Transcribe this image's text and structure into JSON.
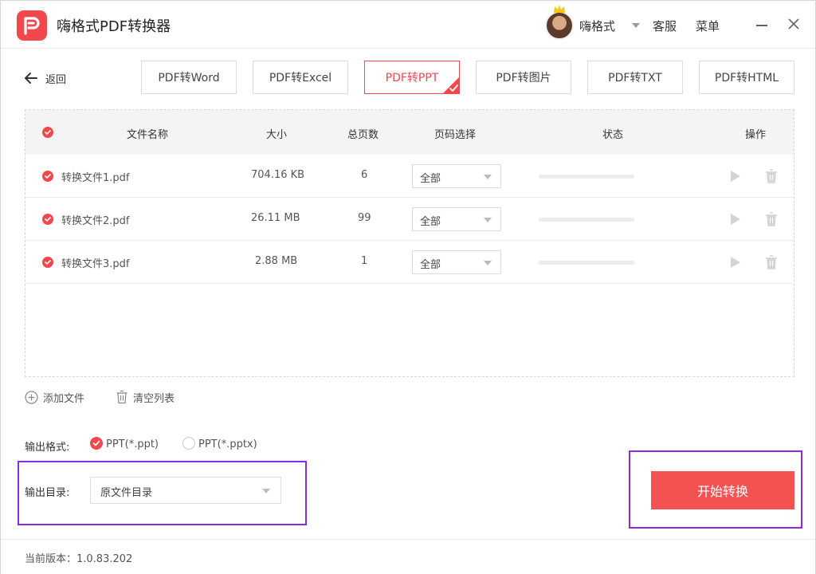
{
  "app": {
    "title": "嗨格式PDF转换器",
    "user_name": "嗨格式",
    "service": "客服",
    "menu": "菜单"
  },
  "toolbar": {
    "back_label": "返回",
    "tabs": [
      {
        "label": "PDF转Word",
        "active": false
      },
      {
        "label": "PDF转Excel",
        "active": false
      },
      {
        "label": "PDF转PPT",
        "active": true
      },
      {
        "label": "PDF转图片",
        "active": false
      },
      {
        "label": "PDF转TXT",
        "active": false
      },
      {
        "label": "PDF转HTML",
        "active": false
      }
    ]
  },
  "table": {
    "headers": {
      "name": "文件名称",
      "size": "大小",
      "pages": "总页数",
      "page_select": "页码选择",
      "status": "状态",
      "action": "操作"
    },
    "rows": [
      {
        "name": "转换文件1.pdf",
        "size": "704.16 KB",
        "pages": "6",
        "page_select": "全部",
        "progress": 0
      },
      {
        "name": "转换文件2.pdf",
        "size": "26.11 MB",
        "pages": "99",
        "page_select": "全部",
        "progress": 0
      },
      {
        "name": "转换文件3.pdf",
        "size": "2.88 MB",
        "pages": "1",
        "page_select": "全部",
        "progress": 0
      }
    ]
  },
  "actions": {
    "add_file": "添加文件",
    "clear_list": "清空列表"
  },
  "output": {
    "format_label": "输出格式:",
    "formats": [
      {
        "label": "PPT(*.ppt)",
        "checked": true
      },
      {
        "label": "PPT(*.pptx)",
        "checked": false
      }
    ],
    "dir_label": "输出目录:",
    "dir_value": "原文件目录"
  },
  "start_button": "开始转换",
  "footer": {
    "version": "当前版本：1.0.83.202"
  },
  "colors": {
    "accent": "#f2474d",
    "highlight": "#8a2be2"
  }
}
